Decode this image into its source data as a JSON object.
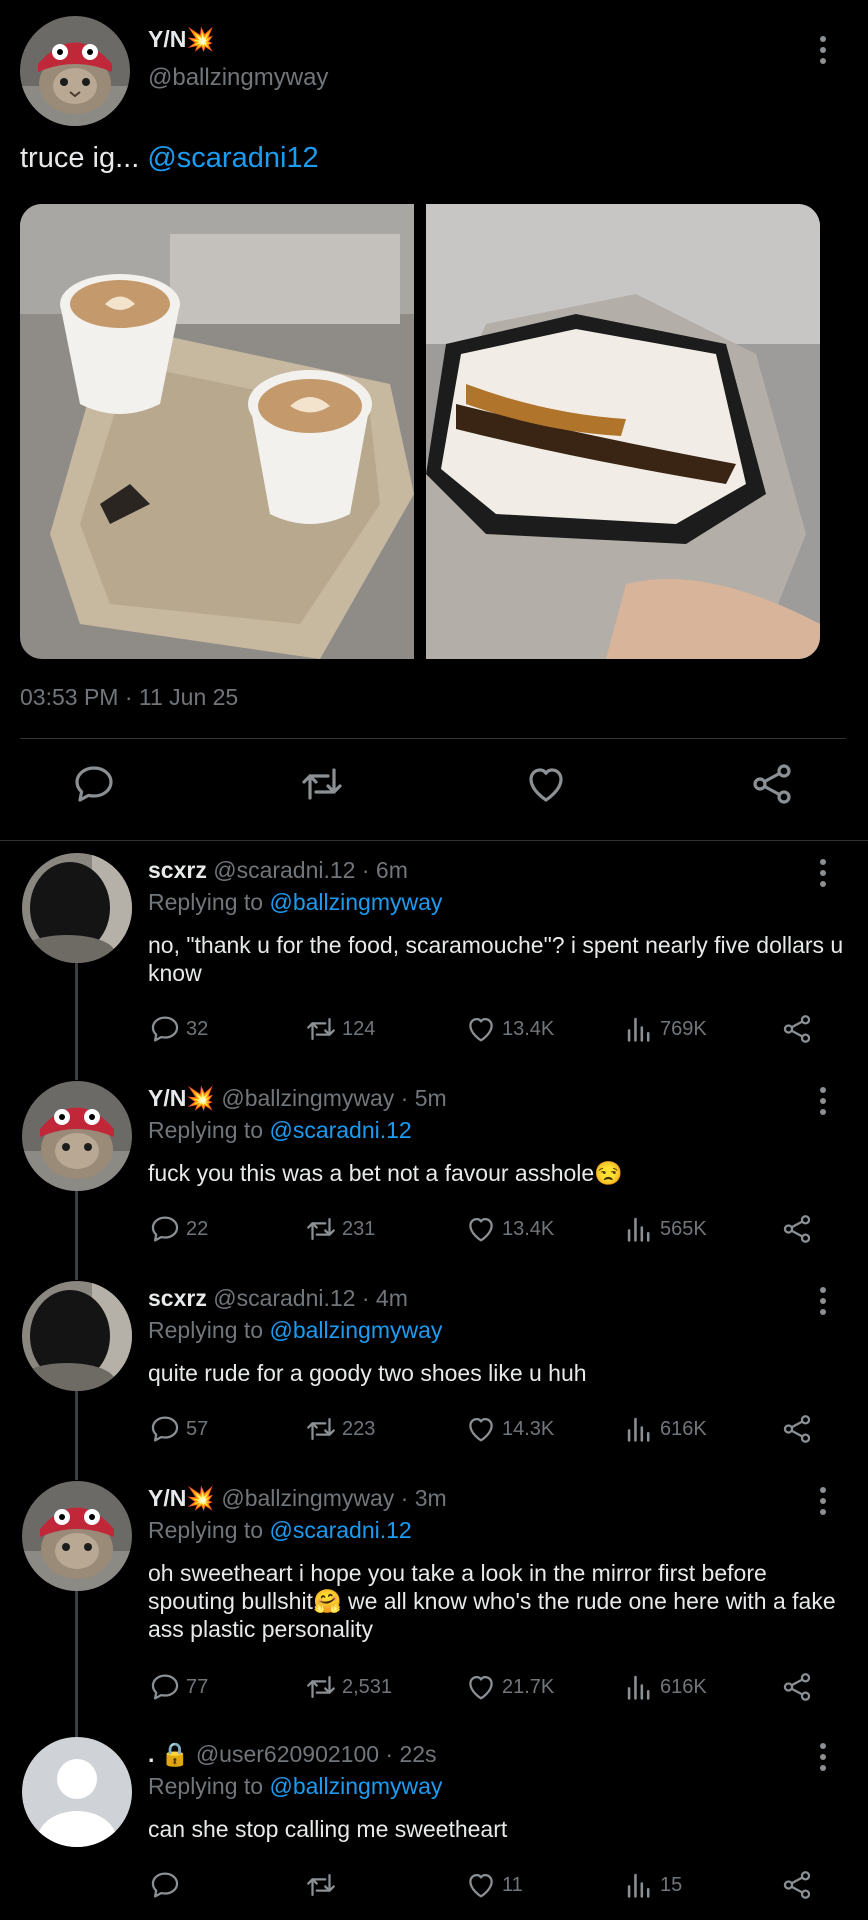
{
  "main_post": {
    "name": "Y/N",
    "name_emoji": "💥",
    "handle": "@ballzingmyway",
    "text": "truce ig...",
    "mention": "@scaradni12",
    "timestamp": "03:53 PM · 11 Jun 25",
    "icons": [
      "reply-icon",
      "retweet-icon",
      "like-icon",
      "share-icon"
    ]
  },
  "replies": [
    {
      "name": "scxrz",
      "name_emoji": "",
      "handle": "@scaradni.12",
      "time": "· 6m",
      "replying_label": "Replying to",
      "replying_to": "@ballzingmyway",
      "text": "no, \"thank u for the food, scaramouche\"? i spent nearly five dollars u know",
      "stats": {
        "replies": "32",
        "retweets": "124",
        "likes": "13.4K",
        "views": "769K"
      }
    },
    {
      "name": "Y/N",
      "name_emoji": "💥",
      "handle": "@ballzingmyway",
      "time": "· 5m",
      "replying_label": "Replying to",
      "replying_to": "@scaradni.12",
      "text": "fuck you this was a bet not a favour asshole😒",
      "stats": {
        "replies": "22",
        "retweets": "231",
        "likes": "13.4K",
        "views": "565K"
      }
    },
    {
      "name": "scxrz",
      "name_emoji": "",
      "handle": "@scaradni.12",
      "time": "· 4m",
      "replying_label": "Replying to",
      "replying_to": "@ballzingmyway",
      "text": "quite rude for a goody two shoes like u huh",
      "stats": {
        "replies": "57",
        "retweets": "223",
        "likes": "14.3K",
        "views": "616K"
      }
    },
    {
      "name": "Y/N",
      "name_emoji": "💥",
      "handle": "@ballzingmyway",
      "time": "· 3m",
      "replying_label": "Replying to",
      "replying_to": "@scaradni.12",
      "text": "oh sweetheart i hope you take a look in the mirror first before spouting bullshit🤗 we all know who's the rude one here with a fake ass plastic personality",
      "stats": {
        "replies": "77",
        "retweets": "2,531",
        "likes": "21.7K",
        "views": "616K"
      }
    },
    {
      "name": ".",
      "name_emoji": "🔒",
      "handle": "@user620902100",
      "time": "· 22s",
      "replying_label": "Replying to",
      "replying_to": "@ballzingmyway",
      "text": "can she stop calling me sweetheart",
      "stats": {
        "replies": "",
        "retweets": "",
        "likes": "11",
        "views": "15"
      }
    }
  ],
  "colors": {
    "background": "#000000",
    "text": "#e7e9ea",
    "muted": "#71767b",
    "link": "#1d9bf0"
  }
}
